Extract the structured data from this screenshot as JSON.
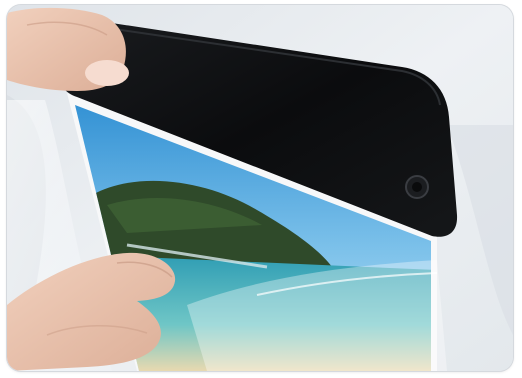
{
  "image": {
    "kind": "photograph",
    "subject_icons": [
      "phone-icon",
      "photo-print-icon",
      "hand-icon",
      "plastic-sleeve-icon"
    ],
    "colors": {
      "background": "#e7ebef",
      "phone_body": "#0b0c0e",
      "print_sky_top": "#2f8fd3",
      "print_sky_bottom": "#bfe3f5",
      "island": "#2f4a2a",
      "sea": "#3aa6b8",
      "sand": "#e8d9b0",
      "skin": "#e9c3ad"
    }
  }
}
